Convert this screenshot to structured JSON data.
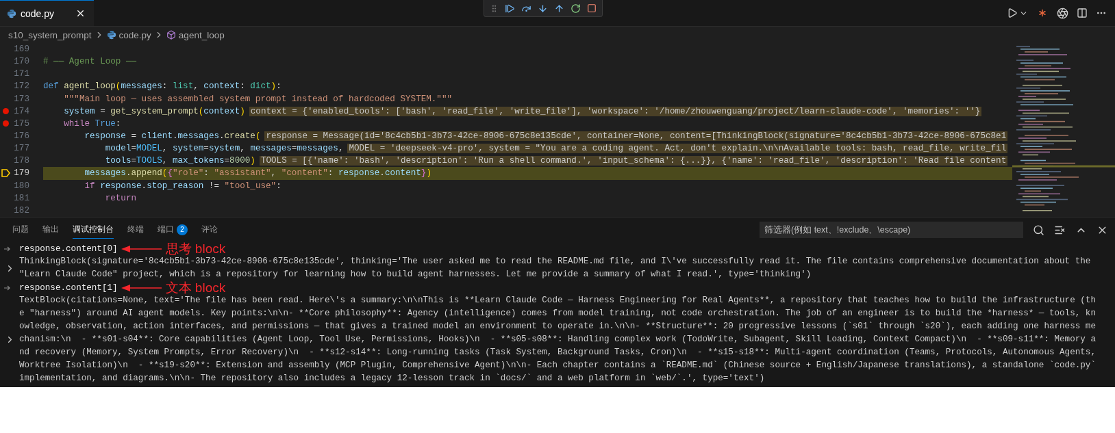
{
  "editor_tabs": [
    {
      "label": "code.py",
      "selected": true
    }
  ],
  "breadcrumbs": [
    {
      "kind": "folder",
      "label": "s10_system_prompt"
    },
    {
      "kind": "file",
      "label": "code.py"
    },
    {
      "kind": "symbol",
      "label": "agent_loop"
    }
  ],
  "editor": {
    "lines": [
      {
        "number": "169",
        "breakpoint": false,
        "current": false
      },
      {
        "number": "170",
        "breakpoint": false,
        "current": false,
        "tokens": [
          {
            "kind": "comment",
            "text": "# ── Agent Loop ──"
          }
        ]
      },
      {
        "number": "171",
        "breakpoint": false,
        "current": false
      },
      {
        "number": "172",
        "breakpoint": false,
        "current": false,
        "tokens": [
          {
            "kind": "keyword",
            "text": "def "
          },
          {
            "kind": "function",
            "text": "agent_loop"
          },
          {
            "kind": "bracket",
            "text": "("
          },
          {
            "kind": "var",
            "text": "messages"
          },
          {
            "kind": "plain",
            "text": ": "
          },
          {
            "kind": "type",
            "text": "list"
          },
          {
            "kind": "plain",
            "text": ", "
          },
          {
            "kind": "var",
            "text": "context"
          },
          {
            "kind": "plain",
            "text": ": "
          },
          {
            "kind": "type",
            "text": "dict"
          },
          {
            "kind": "bracket",
            "text": ")"
          },
          {
            "kind": "plain",
            "text": ":"
          }
        ]
      },
      {
        "number": "173",
        "breakpoint": false,
        "current": false,
        "tokens": [
          {
            "kind": "string",
            "text": "    \"\"\"Main loop — uses assembled system prompt instead of hardcoded SYSTEM.\"\"\""
          }
        ]
      },
      {
        "number": "174",
        "breakpoint": true,
        "current": false,
        "tokens": [
          {
            "kind": "var",
            "text": "    system"
          },
          {
            "kind": "plain",
            "text": " = "
          },
          {
            "kind": "function",
            "text": "get_system_prompt"
          },
          {
            "kind": "bracket",
            "text": "("
          },
          {
            "kind": "var",
            "text": "context"
          },
          {
            "kind": "bracket",
            "text": ")"
          }
        ],
        "hint": "context = {'enabled_tools': ['bash', 'read_file', 'write_file'], 'workspace': '/home/zhouwenguang/project/learn-claude-code', 'memories': ''}"
      },
      {
        "number": "175",
        "breakpoint": true,
        "current": false,
        "tokens": [
          {
            "kind": "control",
            "text": "    while "
          },
          {
            "kind": "keyword",
            "text": "True"
          },
          {
            "kind": "plain",
            "text": ":"
          }
        ]
      },
      {
        "number": "176",
        "breakpoint": false,
        "current": false,
        "tokens": [
          {
            "kind": "var",
            "text": "        response"
          },
          {
            "kind": "plain",
            "text": " = "
          },
          {
            "kind": "var",
            "text": "client"
          },
          {
            "kind": "plain",
            "text": "."
          },
          {
            "kind": "var",
            "text": "messages"
          },
          {
            "kind": "plain",
            "text": "."
          },
          {
            "kind": "function",
            "text": "create"
          },
          {
            "kind": "bracket",
            "text": "("
          }
        ],
        "hint": "response = Message(id='8c4cb5b1-3b73-42ce-8906-675c8e135cde', container=None, content=[ThinkingBlock(signature='8c4cb5b1-3b73-42ce-8906-675c8e1"
      },
      {
        "number": "177",
        "breakpoint": false,
        "current": false,
        "tokens": [
          {
            "kind": "var",
            "text": "            model"
          },
          {
            "kind": "plain",
            "text": "="
          },
          {
            "kind": "constant",
            "text": "MODEL"
          },
          {
            "kind": "plain",
            "text": ", "
          },
          {
            "kind": "var",
            "text": "system"
          },
          {
            "kind": "plain",
            "text": "="
          },
          {
            "kind": "var",
            "text": "system"
          },
          {
            "kind": "plain",
            "text": ", "
          },
          {
            "kind": "var",
            "text": "messages"
          },
          {
            "kind": "plain",
            "text": "="
          },
          {
            "kind": "var",
            "text": "messages"
          },
          {
            "kind": "plain",
            "text": ","
          }
        ],
        "hint": "MODEL = 'deepseek-v4-pro', system = \"You are a coding agent. Act, don't explain.\\n\\nAvailable tools: bash, read_file, write_fil"
      },
      {
        "number": "178",
        "breakpoint": false,
        "current": false,
        "tokens": [
          {
            "kind": "var",
            "text": "            tools"
          },
          {
            "kind": "plain",
            "text": "="
          },
          {
            "kind": "constant",
            "text": "TOOLS"
          },
          {
            "kind": "plain",
            "text": ", "
          },
          {
            "kind": "var",
            "text": "max_tokens"
          },
          {
            "kind": "plain",
            "text": "="
          },
          {
            "kind": "number",
            "text": "8000"
          },
          {
            "kind": "bracket",
            "text": ")"
          }
        ],
        "hint": "TOOLS = [{'name': 'bash', 'description': 'Run a shell command.', 'input_schema': {...}}, {'name': 'read_file', 'description': 'Read file content"
      },
      {
        "number": "179",
        "breakpoint": false,
        "current": true,
        "tokens": [
          {
            "kind": "var",
            "text": "        messages"
          },
          {
            "kind": "plain",
            "text": "."
          },
          {
            "kind": "function",
            "text": "append"
          },
          {
            "kind": "bracket",
            "text": "("
          },
          {
            "kind": "bracket2",
            "text": "{"
          },
          {
            "kind": "string",
            "text": "\"role\""
          },
          {
            "kind": "plain",
            "text": ": "
          },
          {
            "kind": "string",
            "text": "\"assistant\""
          },
          {
            "kind": "plain",
            "text": ", "
          },
          {
            "kind": "string",
            "text": "\"content\""
          },
          {
            "kind": "plain",
            "text": ": "
          },
          {
            "kind": "var",
            "text": "response"
          },
          {
            "kind": "plain",
            "text": "."
          },
          {
            "kind": "var",
            "text": "content"
          },
          {
            "kind": "bracket2",
            "text": "}"
          },
          {
            "kind": "bracket",
            "text": ")"
          }
        ]
      },
      {
        "number": "180",
        "breakpoint": false,
        "current": false,
        "tokens": [
          {
            "kind": "control",
            "text": "        if "
          },
          {
            "kind": "var",
            "text": "response"
          },
          {
            "kind": "plain",
            "text": "."
          },
          {
            "kind": "var",
            "text": "stop_reason"
          },
          {
            "kind": "plain",
            "text": " != "
          },
          {
            "kind": "string",
            "text": "\"tool_use\""
          },
          {
            "kind": "plain",
            "text": ":"
          }
        ]
      },
      {
        "number": "181",
        "breakpoint": false,
        "current": false,
        "tokens": [
          {
            "kind": "control",
            "text": "            return"
          }
        ]
      },
      {
        "number": "182",
        "breakpoint": false,
        "current": false
      }
    ]
  },
  "panel": {
    "tabs": [
      {
        "label": "问题",
        "selected": false
      },
      {
        "label": "输出",
        "selected": false
      },
      {
        "label": "调试控制台",
        "selected": true
      },
      {
        "label": "终端",
        "selected": false
      },
      {
        "label": "端口",
        "selected": false,
        "badge": "2"
      },
      {
        "label": "评论",
        "selected": false
      }
    ],
    "filter": {
      "placeholder": "筛选器(例如 text、!exclude、\\escape)"
    },
    "console": [
      {
        "input": "response.content[0]",
        "annotation": "思考 block",
        "expanded": false,
        "output": [
          "ThinkingBlock(signature='8c4cb5b1-3b73-42ce-8906-675c8e135cde', thinking='The user asked me to read the README.md file, and I\\'ve successfully read it. The file contains comprehensive documentation about the",
          "\"Learn Claude Code\" project, which is a repository for learning how to build agent harnesses. Let me provide a summary of what I read.', type='thinking')"
        ]
      },
      {
        "input": "response.content[1]",
        "annotation": "文本 block",
        "expanded": false,
        "output": [
          "TextBlock(citations=None, text='The file has been read. Here\\'s a summary:\\n\\nThis is **Learn Claude Code — Harness Engineering for Real Agents**, a repository that teaches how to build the infrastructure (th",
          "e \"harness\") around AI agent models. Key points:\\n\\n- **Core philosophy**: Agency (intelligence) comes from model training, not code orchestration. The job of an engineer is to build the *harness* — tools, kn",
          "owledge, observation, action interfaces, and permissions — that gives a trained model an environment to operate in.\\n\\n- **Structure**: 20 progressive lessons (`s01` through `s20`), each adding one harness me",
          "chanism:\\n  - **s01-s04**: Core capabilities (Agent Loop, Tool Use, Permissions, Hooks)\\n  - **s05-s08**: Handling complex work (TodoWrite, Subagent, Skill Loading, Context Compact)\\n  - **s09-s11**: Memory a",
          "nd recovery (Memory, System Prompts, Error Recovery)\\n  - **s12-s14**: Long-running tasks (Task System, Background Tasks, Cron)\\n  - **s15-s18**: Multi-agent coordination (Teams, Protocols, Autonomous Agents,",
          "Worktree Isolation)\\n  - **s19-s20**: Extension and assembly (MCP Plugin, Comprehensive Agent)\\n\\n- Each chapter contains a `README.md` (Chinese source + English/Japanese translations), a standalone `code.py`",
          "implementation, and diagrams.\\n\\n- The repository also includes a legacy 12-lesson track in `docs/` and a web platform in `web/`.', type='text')"
        ]
      }
    ]
  }
}
